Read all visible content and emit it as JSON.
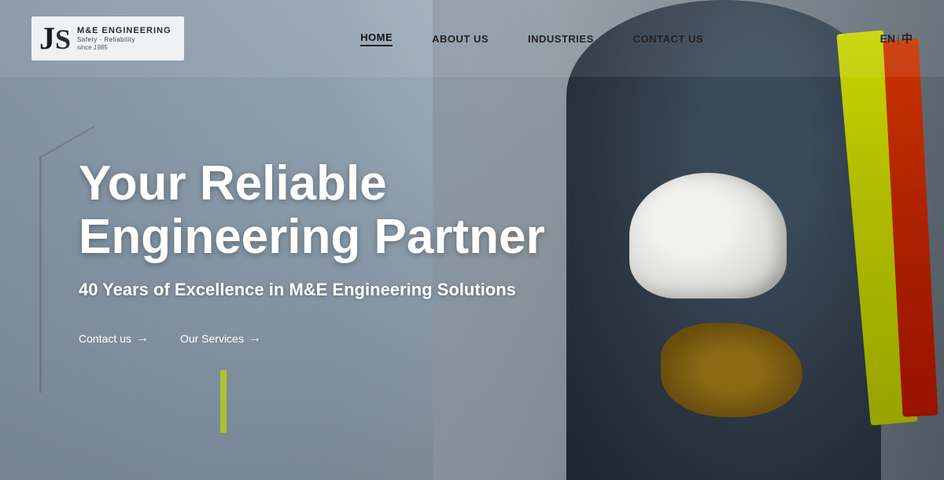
{
  "logo": {
    "initials": "JS",
    "brand": "M&E ENGINEERING",
    "tagline": "Safety · Reliability",
    "since": "since 1985"
  },
  "nav": {
    "links": [
      {
        "label": "HOME",
        "active": true
      },
      {
        "label": "ABOUT US",
        "active": false
      },
      {
        "label": "INDUSTRIES",
        "active": false
      },
      {
        "label": "CONTACT US",
        "active": false
      }
    ],
    "lang_en": "EN",
    "lang_divider": "|",
    "lang_zh": "中"
  },
  "hero": {
    "title": "Your Reliable Engineering Partner",
    "subtitle": "40 Years of Excellence in M&E Engineering Solutions",
    "btn_contact": "Contact us",
    "btn_services": "Our Services",
    "arrow": "→"
  }
}
